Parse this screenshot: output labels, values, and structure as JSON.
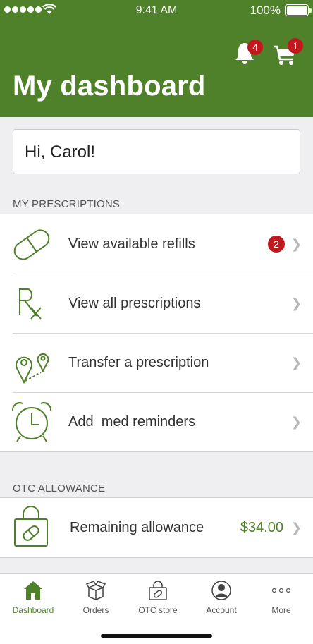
{
  "status_bar": {
    "time": "9:41 AM",
    "battery": "100%"
  },
  "header": {
    "title": "My dashboard",
    "notifications_count": "4",
    "cart_count": "1"
  },
  "greeting": "Hi, Carol!",
  "prescriptions": {
    "section_label": "MY PRESCRIPTIONS",
    "items": [
      {
        "label": "View available refills",
        "icon": "pill-icon",
        "count": "2"
      },
      {
        "label": "View all prescriptions",
        "icon": "rx-icon"
      },
      {
        "label": "Transfer a prescription",
        "icon": "map-pins-icon"
      },
      {
        "label": "Add  med reminders",
        "icon": "alarm-clock-icon"
      }
    ]
  },
  "otc": {
    "section_label": "OTC ALLOWANCE",
    "items": [
      {
        "label": "Remaining allowance",
        "icon": "shopping-bag-icon",
        "amount": "$34.00"
      }
    ]
  },
  "tabbar": {
    "tabs": [
      {
        "label": "Dashboard",
        "icon": "home-icon",
        "active": true
      },
      {
        "label": "Orders",
        "icon": "box-icon"
      },
      {
        "label": "OTC store",
        "icon": "bag-icon"
      },
      {
        "label": "Account",
        "icon": "person-icon"
      },
      {
        "label": "More",
        "icon": "ellipsis-icon"
      }
    ]
  },
  "colors": {
    "brand": "#4e8129",
    "badge": "#c0181c",
    "background": "#efeff2"
  }
}
